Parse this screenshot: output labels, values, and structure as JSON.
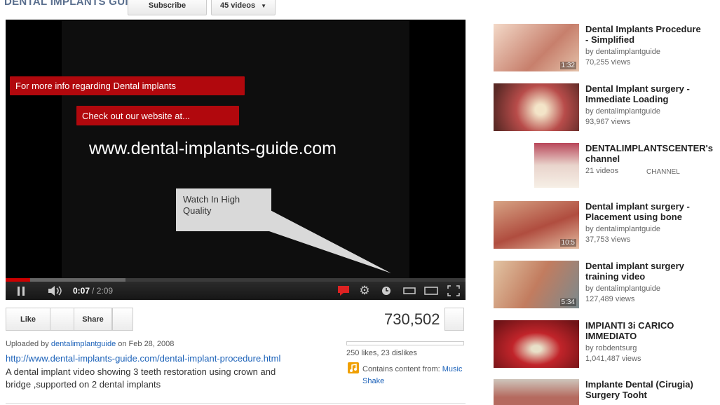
{
  "header": {
    "channel_title": "DENTAL IMPLANTS GUIDE",
    "subscribe_label": "Subscribe",
    "videos_label": "45 videos",
    "videos_chevron_icon": "chevron-down-icon"
  },
  "player": {
    "overlay_label_1": "For more info regarding Dental implants",
    "overlay_label_2": "Check out our website at...",
    "overlay_url": "www.dental-implants-guide.com",
    "bubble_text": "Watch In High Quality",
    "current_time": "0:07",
    "total_time": "/ 2:09",
    "progress_played": 0.054,
    "progress_buffered": 0.26,
    "icons": [
      "pause-icon",
      "volume-icon",
      "annotations-icon",
      "settings-gear-icon",
      "watch-later-icon",
      "small-player-icon",
      "large-player-icon",
      "fullscreen-icon"
    ]
  },
  "actions": {
    "like_label": "Like",
    "share_label": "Share",
    "view_count": "730,502",
    "likes_text": "250 likes, 23 dislikes",
    "likes_ratio": 0.916
  },
  "info": {
    "uploaded_prefix": "Uploaded by",
    "uploader": "dentalimplantguide",
    "uploaded_date": "on Feb 28, 2008",
    "video_link": "http://www.dental-implants-guide.com/dental-implant-procedure.html",
    "description": "A dental implant video showing 3 teeth restoration using crown and bridge ,supported on 2 dental implants",
    "content_from_prefix": "Contains content from:",
    "content_from_link_1": "Music",
    "content_from_link_2": "Shake"
  },
  "related": [
    {
      "title": "Dental Implants Procedure - Simplified",
      "by": "by dentalimplantguide",
      "views": "70,255 views",
      "duration": "1:32"
    },
    {
      "title": "Dental Implant surgery - Immediate Loading",
      "by": "by dentalimplantguide",
      "views": "93,967 views",
      "duration": ""
    },
    {
      "title": "DENTALIMPLANTSCENTER's channel",
      "by": "21 videos",
      "views": "",
      "badge": "CHANNEL"
    },
    {
      "title": "Dental implant surgery - Placement using bone",
      "by": "by dentalimplantguide",
      "views": "37,753 views",
      "duration": "10:5"
    },
    {
      "title": "Dental implant surgery training video",
      "by": "by dentalimplantguide",
      "views": "127,489 views",
      "duration": "5:34"
    },
    {
      "title": "IMPIANTI 3i CARICO IMMEDIATO",
      "by": "by robdentsurg",
      "views": "1,041,487 views",
      "duration": ""
    },
    {
      "title": "Implante Dental (Cirugia) Surgery Tooht",
      "by": "",
      "views": "",
      "duration": ""
    }
  ]
}
